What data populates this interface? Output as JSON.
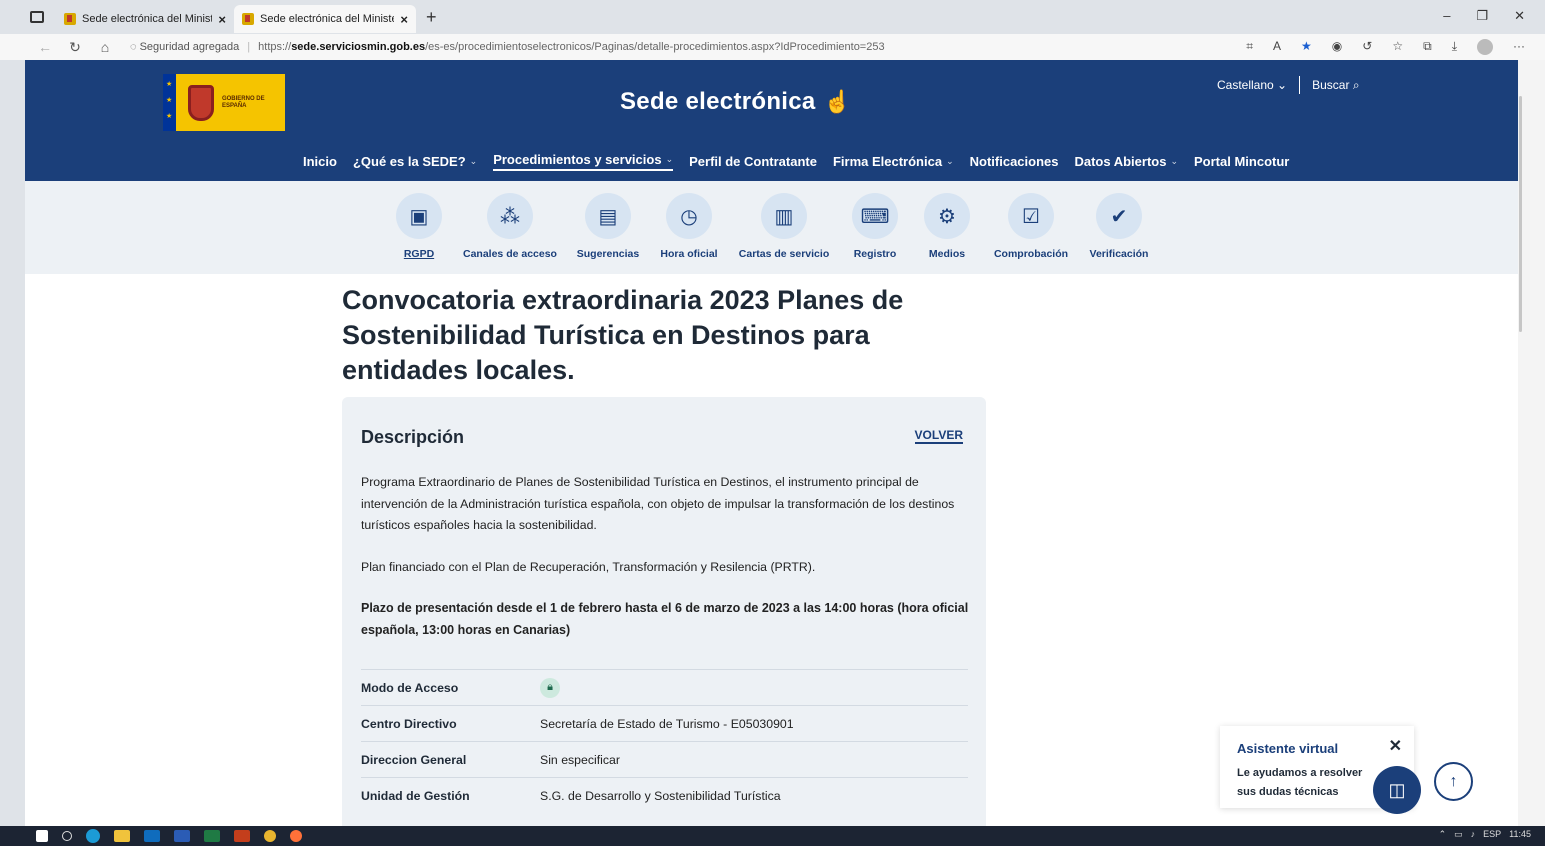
{
  "browser": {
    "tabs": [
      {
        "title": "Sede electrónica del Ministerio d"
      },
      {
        "title": "Sede electrónica del Ministerio d"
      }
    ],
    "security_label": "Seguridad agregada",
    "url_prefix": "https://",
    "url_domain": "sede.serviciosmin.gob.es",
    "url_path": "/es-es/procedimientoselectronicos/Paginas/detalle-procedimientos.aspx?IdProcedimiento=253"
  },
  "header": {
    "logo_text": "GOBIERNO DE ESPAÑA",
    "site_title": "Sede electrónica",
    "language": "Castellano",
    "search_label": "Buscar",
    "nav": [
      {
        "label": "Inicio"
      },
      {
        "label": "¿Qué es la SEDE?"
      },
      {
        "label": "Procedimientos y servicios"
      },
      {
        "label": "Perfil de Contratante"
      },
      {
        "label": "Firma Electrónica"
      },
      {
        "label": "Notificaciones"
      },
      {
        "label": "Datos Abiertos"
      },
      {
        "label": "Portal Mincotur"
      }
    ]
  },
  "quick_links": [
    {
      "label": "RGPD",
      "icon": "id-card-icon"
    },
    {
      "label": "Canales de acceso",
      "icon": "network-icon"
    },
    {
      "label": "Sugerencias",
      "icon": "comment-icon"
    },
    {
      "label": "Hora oficial",
      "icon": "clock-icon"
    },
    {
      "label": "Cartas de servicio",
      "icon": "document-icon"
    },
    {
      "label": "Registro",
      "icon": "laptop-icon"
    },
    {
      "label": "Medios",
      "icon": "settings-window-icon"
    },
    {
      "label": "Comprobación",
      "icon": "checklist-icon"
    },
    {
      "label": "Verificación",
      "icon": "verify-icon"
    }
  ],
  "main": {
    "title": "Convocatoria extraordinaria 2023 Planes de Sostenibilidad Turística en Destinos para entidades locales.",
    "card_title": "Descripción",
    "back_label": "VOLVER",
    "paragraph1": "Programa Extraordinario de Planes de Sostenibilidad Turística en Destinos, el instrumento principal de intervención de la Administración turística española, con objeto de impulsar la transformación de los destinos turísticos españoles hacia la sostenibilidad.",
    "paragraph2": "Plan financiado con el Plan de Recuperación, Transformación y Resilencia (PRTR).",
    "paragraph3": "Plazo de presentación desde el 1 de febrero hasta el 6 de marzo de 2023 a las 14:00 horas (hora oficial española, 13:00 horas en Canarias)",
    "details": [
      {
        "key": "Modo de Acceso",
        "value": ""
      },
      {
        "key": "Centro Directivo",
        "value": "Secretaría de Estado de Turismo - E05030901"
      },
      {
        "key": "Direccion General",
        "value": "Sin especificar"
      },
      {
        "key": "Unidad de Gestión",
        "value": "S.G. de Desarrollo y Sostenibilidad Turística"
      }
    ]
  },
  "assistant": {
    "title": "Asistente virtual",
    "subtitle": "Le ayudamos a resolver sus dudas técnicas"
  },
  "taskbar": {
    "lang": "ESP",
    "time": "11:45"
  },
  "colors": {
    "brand_blue": "#1b3f7a",
    "panel_bg": "#edf1f5"
  }
}
